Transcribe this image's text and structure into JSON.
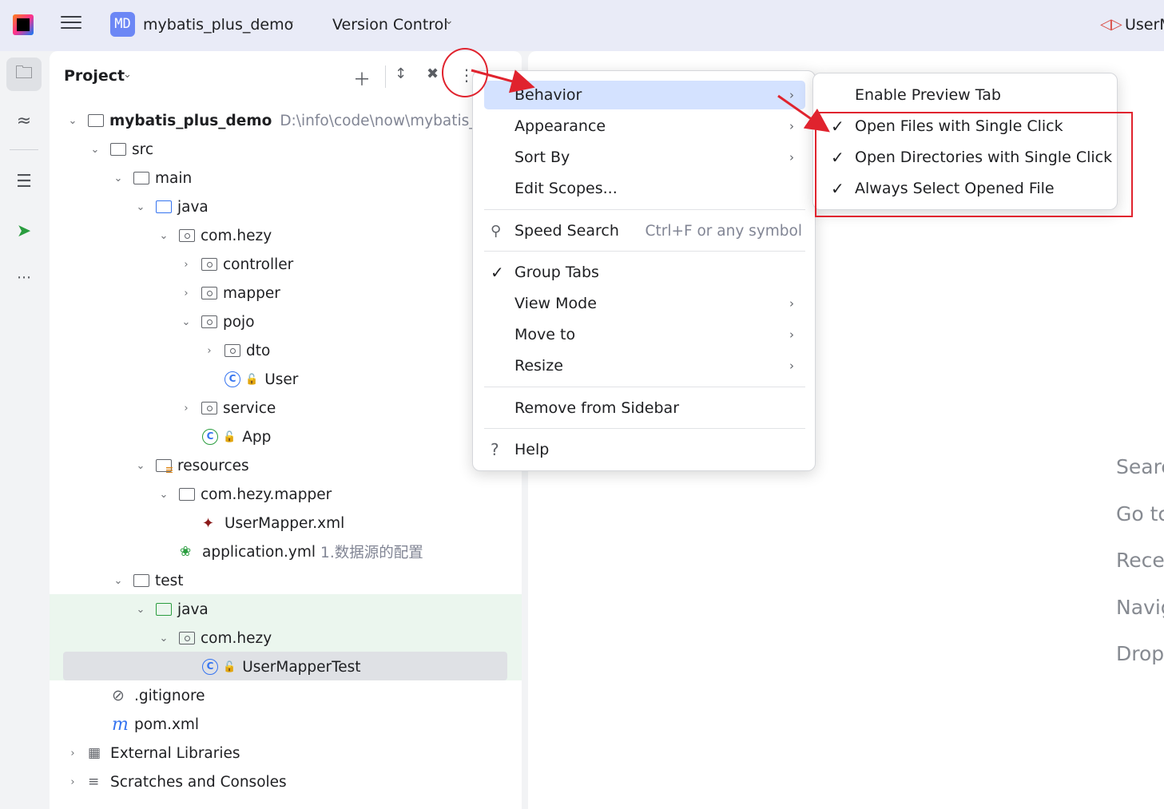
{
  "titlebar": {
    "project_badge": "MD",
    "project_name": "mybatis_plus_demo",
    "vcs_label": "Version Control",
    "run_config_label": "UserM"
  },
  "panel": {
    "title": "Project",
    "tree": [
      {
        "label": "mybatis_plus_demo",
        "path": "D:\\info\\code\\now\\mybatis_plu"
      },
      {
        "label": "src"
      },
      {
        "label": "main"
      },
      {
        "label": "java"
      },
      {
        "label": "com.hezy"
      },
      {
        "label": "controller"
      },
      {
        "label": "mapper"
      },
      {
        "label": "pojo"
      },
      {
        "label": "dto"
      },
      {
        "label": "User"
      },
      {
        "label": "service"
      },
      {
        "label": "App"
      },
      {
        "label": "resources"
      },
      {
        "label": "com.hezy.mapper"
      },
      {
        "label": "UserMapper.xml"
      },
      {
        "label": "application.yml",
        "note": "1.数据源的配置"
      },
      {
        "label": "test"
      },
      {
        "label": "java"
      },
      {
        "label": "com.hezy"
      },
      {
        "label": "UserMapperTest"
      },
      {
        "label": ".gitignore"
      },
      {
        "label": "pom.xml"
      },
      {
        "label": "External Libraries"
      },
      {
        "label": "Scratches and Consoles"
      }
    ]
  },
  "menu": {
    "items": [
      {
        "label": "Behavior"
      },
      {
        "label": "Appearance"
      },
      {
        "label": "Sort By"
      },
      {
        "label": "Edit Scopes..."
      },
      {
        "label": "Speed Search",
        "shortcut": "Ctrl+F or any symbol"
      },
      {
        "label": "Group Tabs"
      },
      {
        "label": "View Mode"
      },
      {
        "label": "Move to"
      },
      {
        "label": "Resize"
      },
      {
        "label": "Remove from Sidebar"
      },
      {
        "label": "Help"
      }
    ]
  },
  "submenu": {
    "items": [
      {
        "label": "Enable Preview Tab",
        "checked": false
      },
      {
        "label": "Open Files with Single Click",
        "checked": true
      },
      {
        "label": "Open Directories with Single Click",
        "checked": true
      },
      {
        "label": "Always Select Opened File",
        "checked": true
      }
    ]
  },
  "editor": {
    "hints": [
      "Searc",
      "Go tc",
      "Recer",
      "Navig",
      "Drop"
    ]
  },
  "colors": {
    "accent": "#3574f0",
    "highlight": "#d4e2ff",
    "annotation": "#e0232e",
    "selection": "#dfe1e5",
    "test_band": "#ebf6ee"
  }
}
